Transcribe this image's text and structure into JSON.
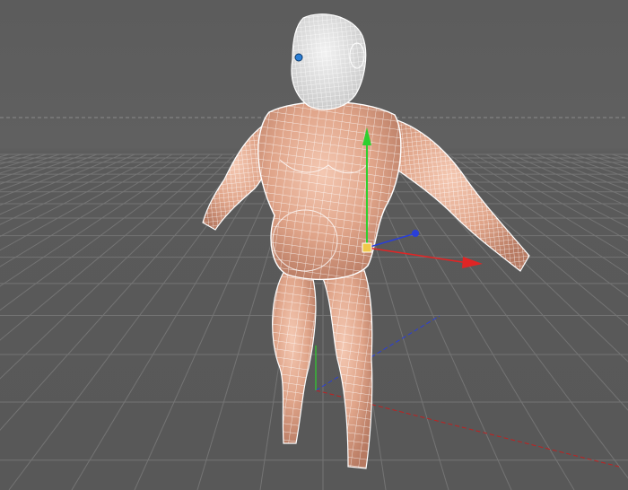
{
  "viewport": {
    "background": "#5e5e5e",
    "grid_color": "#747474",
    "horizon_line_color": "#8a8a8a"
  },
  "model": {
    "skin_color": "#e8b29a",
    "wire_color": "#ffffff",
    "eye_color": "#2b7fd6"
  },
  "gizmo": {
    "x_axis_color": "#e02525",
    "y_axis_color": "#2fcf2f",
    "z_axis_color": "#2a3fd8",
    "pivot_color": "#f0c84a"
  }
}
